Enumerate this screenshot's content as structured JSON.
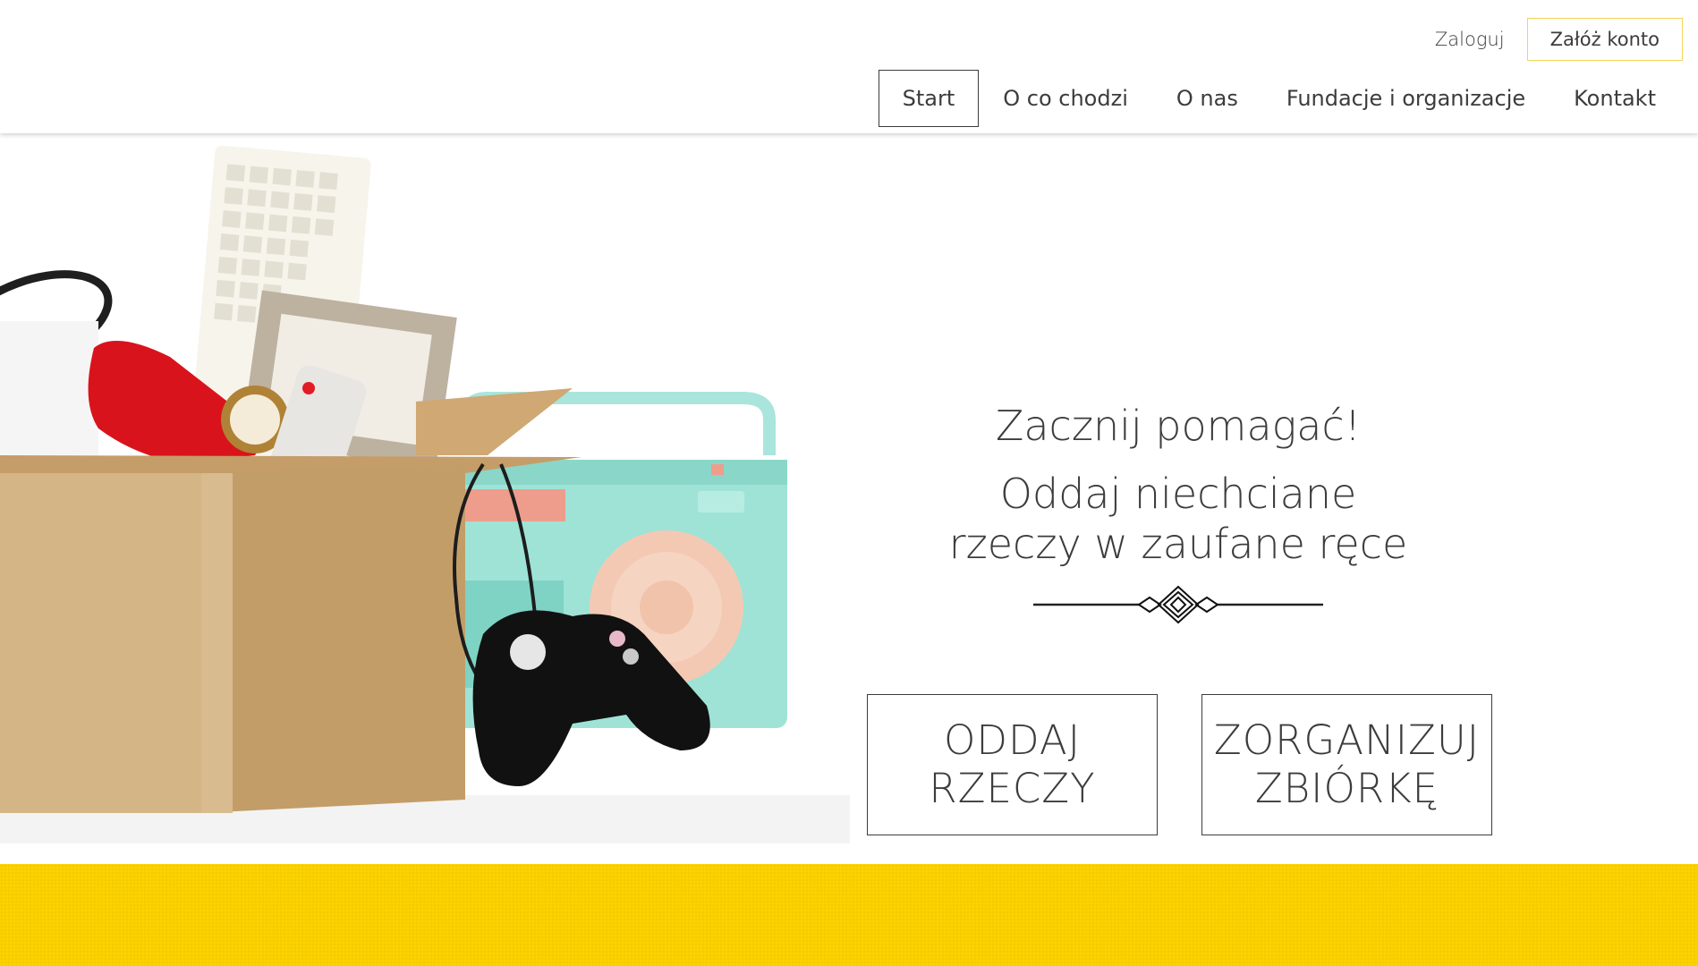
{
  "header": {
    "login_label": "Zaloguj",
    "register_label": "Załóż konto",
    "nav": [
      "Start",
      "O co chodzi",
      "O nas",
      "Fundacje i organizacje",
      "Kontakt"
    ],
    "active_nav": "Start"
  },
  "hero": {
    "heading": "Zacznij pomagać!",
    "subheading": "Oddaj niechciane rzeczy w zaufane ręce",
    "cta_give_label": "ODDAJ\nRZECZY",
    "cta_collect_label": "ZORGANIZUJ\nZBIÓRKĘ"
  },
  "colors": {
    "accent_yellow": "#fbd200",
    "text": "#3c3c3c",
    "register_border": "#f2d45b"
  }
}
